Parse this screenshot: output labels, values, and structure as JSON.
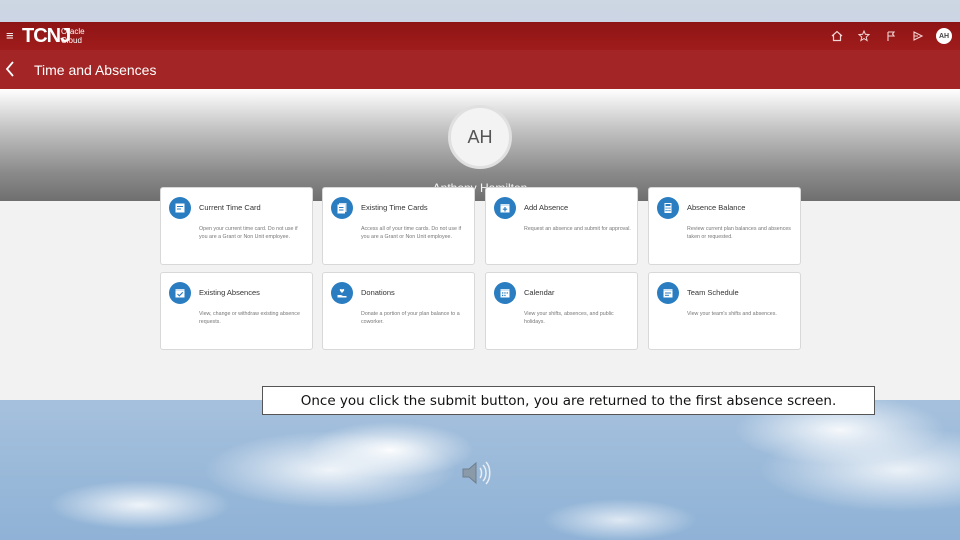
{
  "app": {
    "logo": "TCNJ",
    "logo_sub_1": "Oracle",
    "logo_sub_2": "Cloud",
    "user_initials": "AH",
    "page_title": "Time and Absences",
    "colors": {
      "topbar": "#8e1414",
      "subbar": "#a32525",
      "icon_blue": "#2a7dc0"
    }
  },
  "topbar_icons": [
    "home-icon",
    "star-icon",
    "flag-icon",
    "notification-icon"
  ],
  "profile": {
    "initials": "AH",
    "name": "Anthony Hamilton"
  },
  "cards": [
    {
      "title": "Current Time Card",
      "desc": "Open your current time card. Do not use if you are a Grant or Non Unit employee.",
      "icon": "timecard-icon"
    },
    {
      "title": "Existing Time Cards",
      "desc": "Access all of your time cards. Do not use if you are a Grant or Non Unit employee.",
      "icon": "timecards-icon"
    },
    {
      "title": "Add Absence",
      "desc": "Request an absence and submit for approval.",
      "icon": "add-absence-icon"
    },
    {
      "title": "Absence Balance",
      "desc": "Review current plan balances and absences taken or requested.",
      "icon": "calculator-icon"
    },
    {
      "title": "Existing Absences",
      "desc": "View, change or withdraw existing absence requests.",
      "icon": "absences-icon"
    },
    {
      "title": "Donations",
      "desc": "Donate a portion of your plan balance to a coworker.",
      "icon": "donation-icon"
    },
    {
      "title": "Calendar",
      "desc": "View your shifts, absences, and public holidays.",
      "icon": "calendar-icon"
    },
    {
      "title": "Team Schedule",
      "desc": "View your team's shifts and absences.",
      "icon": "schedule-icon"
    }
  ],
  "caption": "Once you click the submit button, you are returned to the first absence screen."
}
